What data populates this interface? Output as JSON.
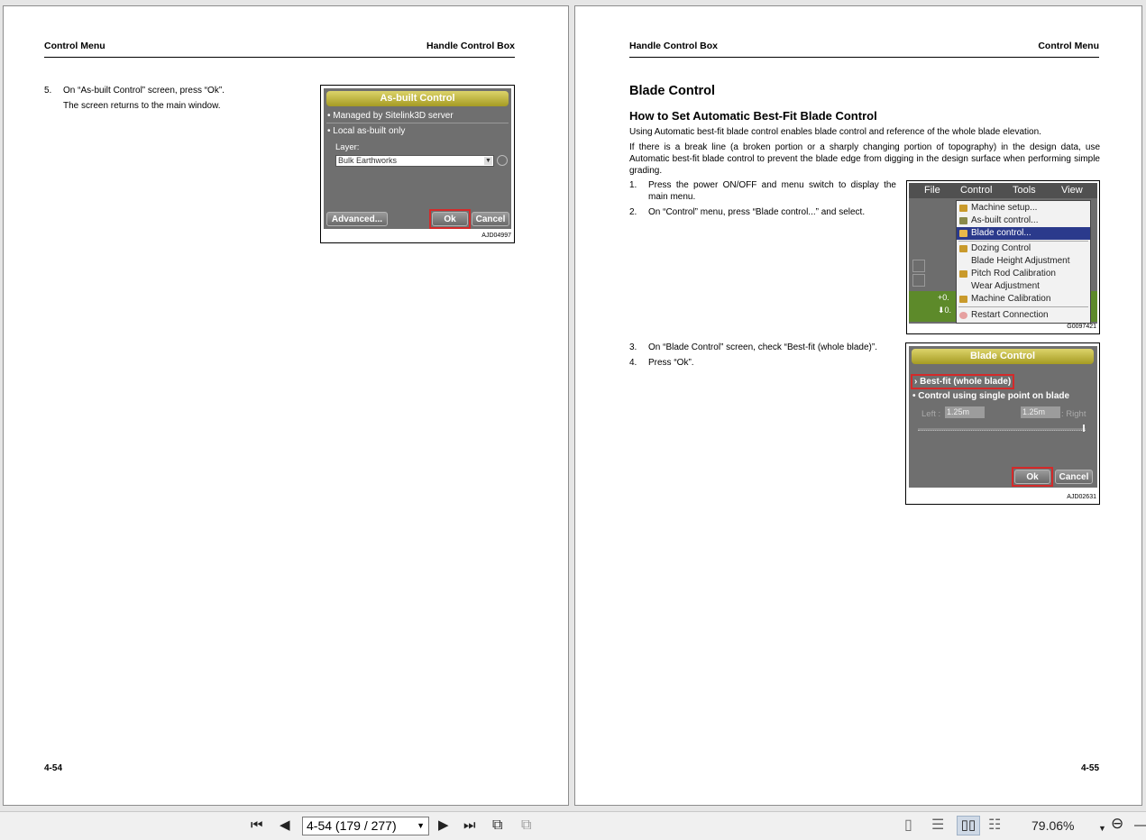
{
  "left_page": {
    "header_left": "Control Menu",
    "header_right": "Handle Control Box",
    "step5_num": "5.",
    "step5_text": "On “As-built Control” screen, press “Ok”.",
    "step5_sub": "The screen returns to the main window.",
    "page_number": "4-54",
    "figure": {
      "title": "As-built Control",
      "opt_server": "Managed by Sitelink3D server",
      "opt_local": "Local as-built only",
      "layer_label": "Layer:",
      "layer_value": "Bulk Earthworks",
      "btn_advanced": "Advanced...",
      "btn_ok": "Ok",
      "btn_cancel": "Cancel",
      "figure_id": "AJD04997"
    }
  },
  "right_page": {
    "header_left": "Handle Control Box",
    "header_right": "Control Menu",
    "section_title": "Blade Control",
    "subsection_title": "How to Set Automatic Best-Fit Blade Control",
    "para1": "Using Automatic best-fit blade control enables blade control and reference of the whole blade elevation.",
    "para2": "If there is a break line (a broken portion or a sharply changing portion of topography) in the design data, use Automatic best-fit blade control to prevent the blade edge from digging in the design surface when performing simple grading.",
    "steps": [
      {
        "num": "1.",
        "text": "Press the power ON/OFF and menu switch to display the main menu."
      },
      {
        "num": "2.",
        "text": "On “Control” menu, press “Blade control...” and select."
      },
      {
        "num": "3.",
        "text": "On “Blade Control” screen, check “Best-fit (whole blade)”."
      },
      {
        "num": "4.",
        "text": "Press “Ok”."
      }
    ],
    "page_number": "4-55",
    "menu_figure": {
      "menubar": [
        "File",
        "Control",
        "Tools",
        "View"
      ],
      "items": [
        "Machine setup...",
        "As-built control...",
        "Blade control...",
        "Dozing Control",
        "Blade Height Adjustment",
        "Pitch Rod Calibration",
        "Wear Adjustment",
        "Machine Calibration",
        "Restart Connection"
      ],
      "readout_top": "+0.",
      "readout_bottom": "0.",
      "figure_id": "G0097421"
    },
    "blade_figure": {
      "title": "Blade Control",
      "opt_bestfit": "Best-fit (whole blade)",
      "opt_single": "Control using single point on blade",
      "left_label": "Left :",
      "left_value": "1.25m",
      "right_value": "1.25m",
      "right_label": ": Right",
      "btn_ok": "Ok",
      "btn_cancel": "Cancel",
      "figure_id": "AJD02631"
    }
  },
  "toolbar": {
    "page_field": "4-54 (179 / 277)",
    "zoom": "79.06%",
    "icons": [
      "first-page-icon",
      "prev-page-icon",
      "next-page-icon",
      "last-page-icon",
      "prev-view-icon",
      "next-view-icon",
      "single-page-icon",
      "continuous-icon",
      "facing-icon",
      "continuous-facing-icon",
      "zoom-out-icon"
    ]
  }
}
